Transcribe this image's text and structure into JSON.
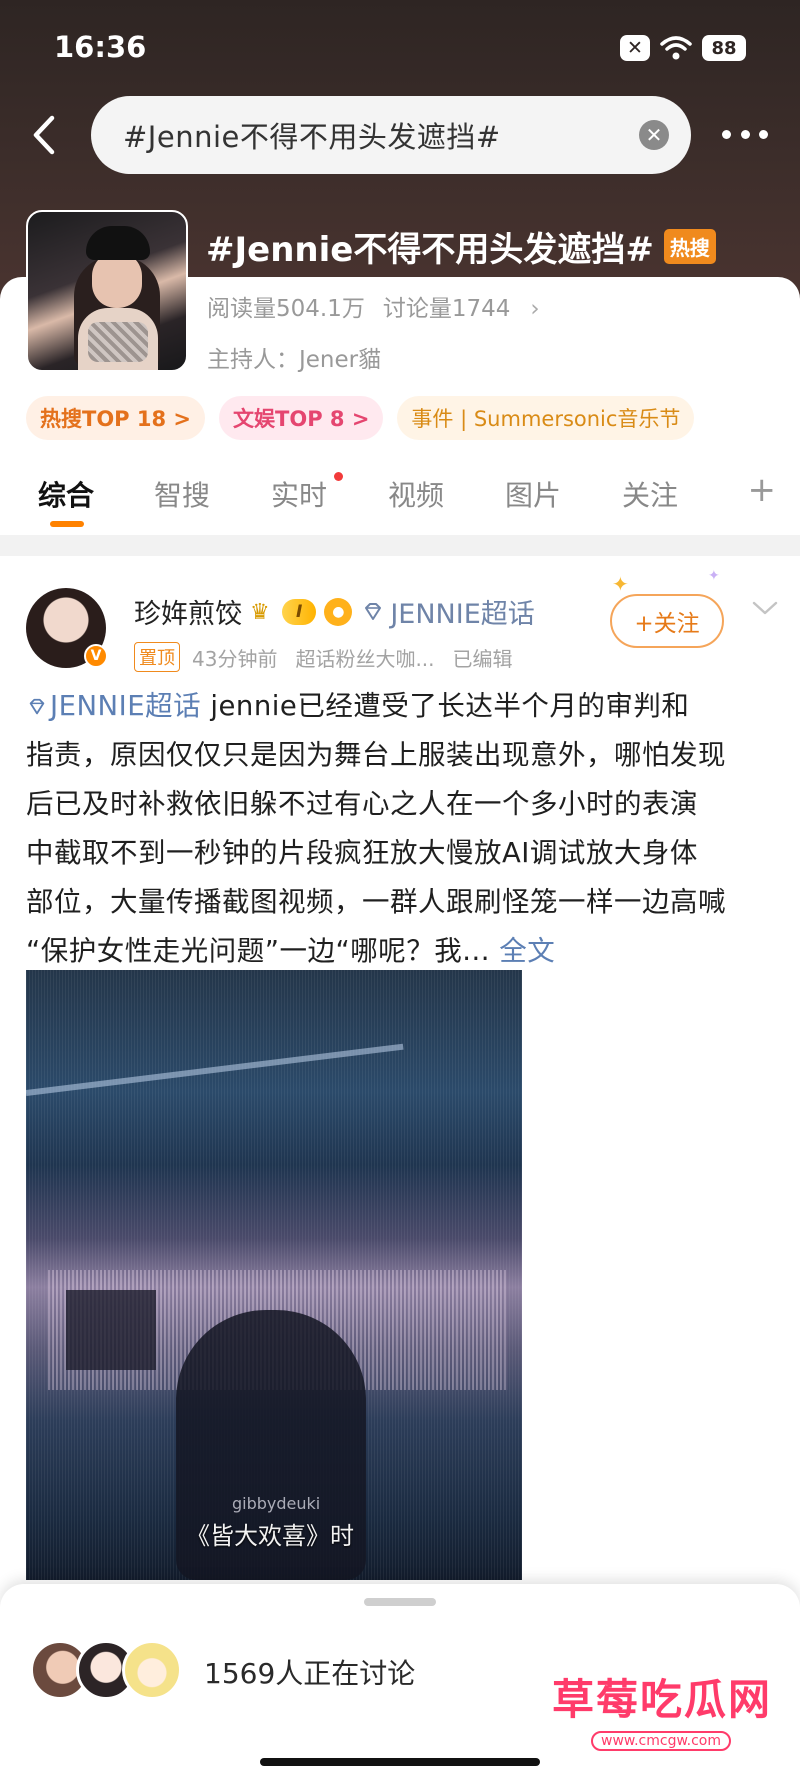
{
  "status_bar": {
    "time": "16:36",
    "sim_icon": "x-icon",
    "battery": "88"
  },
  "nav": {
    "search_query": "#Jennie不得不用头发遮挡#"
  },
  "topic": {
    "title": "#Jennie不得不用头发遮挡#",
    "hot_tag": "热搜",
    "reads": "阅读量504.1万",
    "discussions": "讨论量1744",
    "host": "主持人：Jener貓",
    "chips": [
      "热搜TOP 18 >",
      "文娱TOP 8 >",
      "事件 | Summersonic音乐节"
    ]
  },
  "tabs": [
    "综合",
    "智搜",
    "实时",
    "视频",
    "图片",
    "关注"
  ],
  "post": {
    "author": "珍姩煎饺",
    "level_badge": "I",
    "super_topic": "JENNIE超话",
    "follow_label": "+关注",
    "pin_tag": "置顶",
    "time": "43分钟前",
    "source": "超话粉丝大咖...",
    "edited": "已编辑",
    "topic_link": "JENNIE超话",
    "lines": [
      "jennie已经遭受了长达半个月的审判和",
      "指责，原因仅仅只是因为舞台上服装出现意外，哪怕发现",
      "后已及时补救依旧躲不过有心之人在一个多小时的表演",
      "中截取不到一秒钟的片段疯狂放大慢放AI调试放大身体",
      "部位，大量传播截图视频，一群人跟刷怪笼一样一边高喊",
      "“保护女性走光问题”一边“哪呢？我..."
    ],
    "full_text_link": "全文",
    "video_watermark": "gibbydeuki",
    "video_subtitle": "《皆大欢喜》时"
  },
  "sheet": {
    "discussing": "1569人正在讨论"
  },
  "watermark": {
    "brand": "草莓吃瓜网",
    "url": "www.cmcgw.com"
  }
}
